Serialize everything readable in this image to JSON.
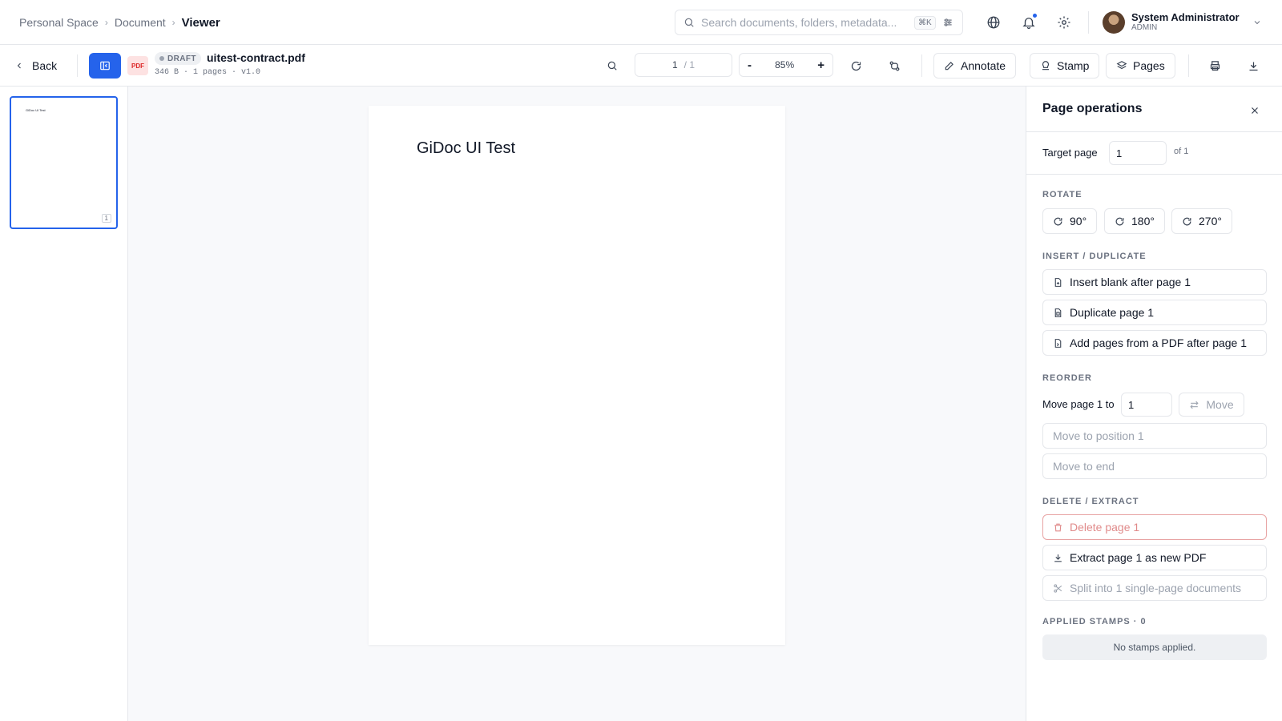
{
  "breadcrumb": {
    "items": [
      "Personal Space",
      "Document"
    ],
    "current": "Viewer"
  },
  "search": {
    "placeholder": "Search documents, folders, metadata...",
    "shortcut": "⌘K"
  },
  "user": {
    "name": "System Administrator",
    "role": "ADMIN"
  },
  "toolbar": {
    "back_label": "Back",
    "file_type": "PDF",
    "status": "DRAFT",
    "filename": "uitest-contract.pdf",
    "meta": "346 B · 1 pages · v1.0",
    "page_current": "1",
    "page_total": "/ 1",
    "zoom_out": "-",
    "zoom_level": "85%",
    "zoom_in": "+",
    "annotate_label": "Annotate",
    "stamp_label": "Stamp",
    "pages_label": "Pages"
  },
  "thumbnails": [
    {
      "text": "GiDoc UI Test",
      "number": "1"
    }
  ],
  "document": {
    "page_text": "GiDoc UI Test"
  },
  "panel": {
    "title": "Page operations",
    "target_label": "Target page",
    "target_value": "1",
    "target_of": "of 1",
    "rotate": {
      "label": "ROTATE",
      "options": [
        "90°",
        "180°",
        "270°"
      ]
    },
    "insert": {
      "label": "INSERT / DUPLICATE",
      "insert_blank": "Insert blank after page 1",
      "duplicate": "Duplicate page 1",
      "add_pages": "Add pages from a PDF after page 1"
    },
    "reorder": {
      "label": "REORDER",
      "move_label": "Move page 1 to",
      "move_value": "1",
      "move_button": "Move",
      "move_position": "Move to position 1",
      "move_end": "Move to end"
    },
    "delete_extract": {
      "label": "DELETE / EXTRACT",
      "delete": "Delete page 1",
      "extract": "Extract page 1 as new PDF",
      "split": "Split into 1 single-page documents"
    },
    "stamps": {
      "label": "APPLIED STAMPS · 0",
      "empty": "No stamps applied."
    }
  },
  "colors": {
    "accent": "#2563eb",
    "danger": "#dc2626",
    "border": "#e5e7eb",
    "canvas": "#f8f9fb"
  }
}
